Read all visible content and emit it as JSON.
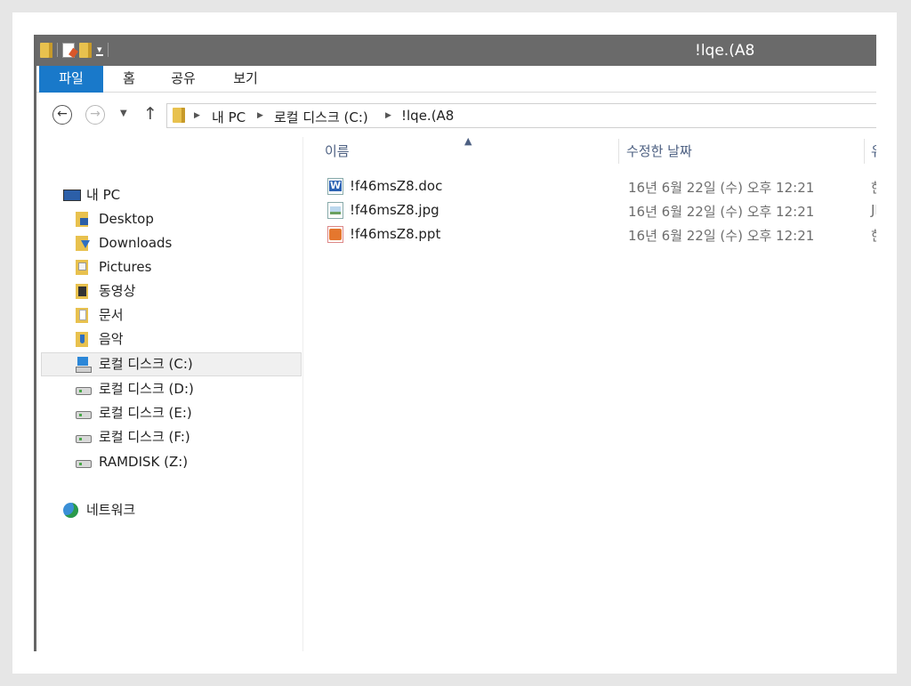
{
  "window": {
    "title": "!lqe.(A8"
  },
  "ribbon": {
    "tabs": [
      {
        "label": "파일"
      },
      {
        "label": "홈"
      },
      {
        "label": "공유"
      },
      {
        "label": "보기"
      }
    ]
  },
  "address": {
    "crumbs": [
      "내 PC",
      "로컬 디스크 (C:)",
      "!lqe.(A8"
    ]
  },
  "navpane": {
    "this_pc": "내 PC",
    "items": [
      {
        "label": "Desktop",
        "icon": "desktop-folder-icon"
      },
      {
        "label": "Downloads",
        "icon": "downloads-folder-icon"
      },
      {
        "label": "Pictures",
        "icon": "pictures-folder-icon"
      },
      {
        "label": "동영상",
        "icon": "videos-folder-icon"
      },
      {
        "label": "문서",
        "icon": "documents-folder-icon"
      },
      {
        "label": "음악",
        "icon": "music-folder-icon"
      }
    ],
    "drives": [
      {
        "label": "로컬 디스크 (C:)",
        "selected": true
      },
      {
        "label": "로컬 디스크 (D:)"
      },
      {
        "label": "로컬 디스크 (E:)"
      },
      {
        "label": "로컬 디스크 (F:)"
      },
      {
        "label": "RAMDISK (Z:)"
      }
    ],
    "network": "네트워크"
  },
  "content": {
    "columns": {
      "name": "이름",
      "modified": "수정한 날짜",
      "type": "유"
    },
    "files": [
      {
        "name": "!f46msZ8.doc",
        "modified": "16년 6월 22일 (수) 오후 12:21",
        "type": "한",
        "kind": "word-doc-icon"
      },
      {
        "name": "!f46msZ8.jpg",
        "modified": "16년 6월 22일 (수) 오후 12:21",
        "type": "JI",
        "kind": "image-file-icon"
      },
      {
        "name": "!f46msZ8.ppt",
        "modified": "16년 6월 22일 (수) 오후 12:21",
        "type": "한",
        "kind": "powerpoint-file-icon"
      }
    ]
  }
}
